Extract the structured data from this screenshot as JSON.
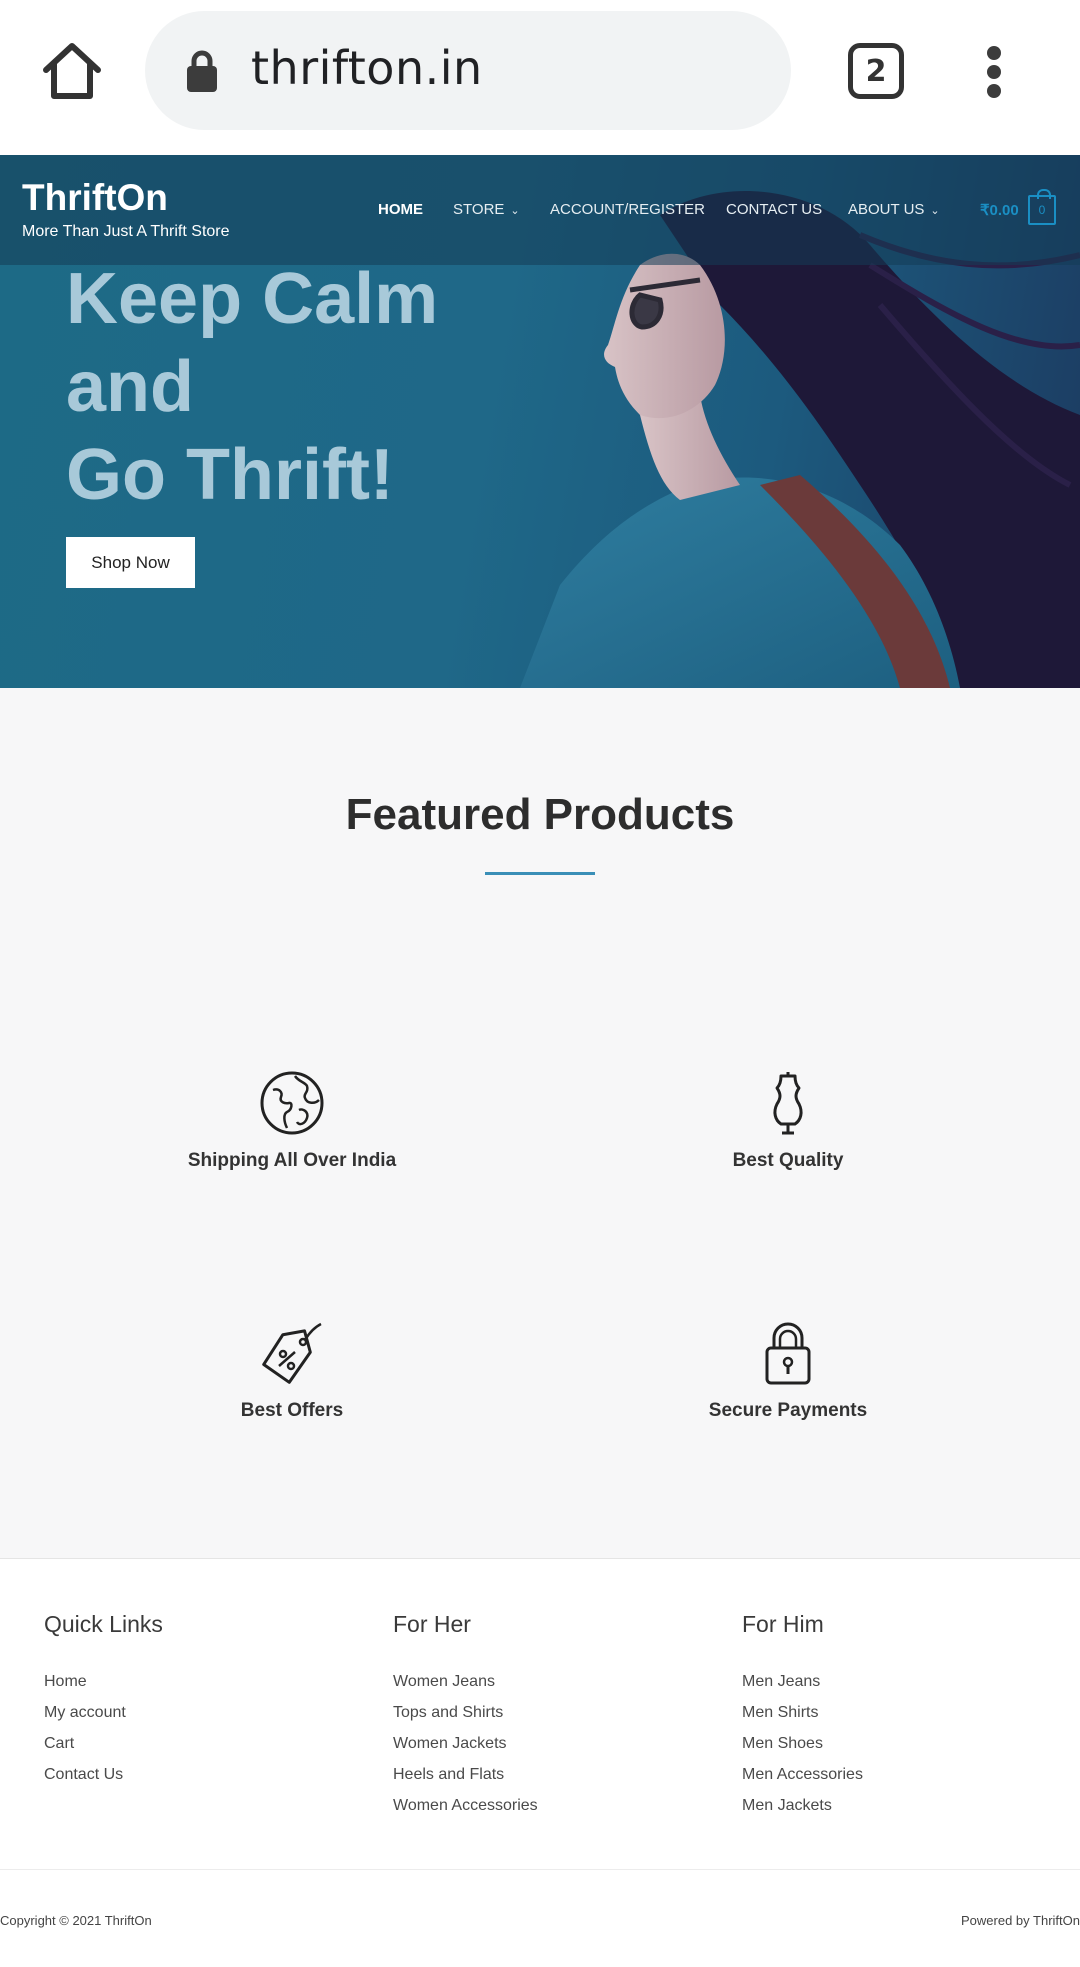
{
  "browser": {
    "url": "thrifton.in",
    "tab_count": "2"
  },
  "site": {
    "title": "ThriftOn",
    "tagline": "More Than Just A Thrift Store"
  },
  "nav": {
    "items": [
      {
        "label": "HOME",
        "active": true,
        "has_dropdown": false
      },
      {
        "label": "STORE",
        "active": false,
        "has_dropdown": true
      },
      {
        "label": "ACCOUNT/REGISTER",
        "active": false,
        "has_dropdown": false
      },
      {
        "label": "CONTACT US",
        "active": false,
        "has_dropdown": false
      },
      {
        "label": "ABOUT US",
        "active": false,
        "has_dropdown": true
      }
    ],
    "cart_amount": "₹0.00",
    "cart_count": "0"
  },
  "hero": {
    "headline_line1": "Keep Calm",
    "headline_line2": "and",
    "headline_line3": "Go Thrift!",
    "button_label": "Shop Now"
  },
  "featured": {
    "title": "Featured Products"
  },
  "features": [
    {
      "label": "Shipping All Over India",
      "icon": "globe-icon"
    },
    {
      "label": "Best Quality",
      "icon": "dress-form-icon"
    },
    {
      "label": "Best Offers",
      "icon": "price-tag-icon"
    },
    {
      "label": "Secure Payments",
      "icon": "padlock-icon"
    }
  ],
  "footer": {
    "columns": [
      {
        "heading": "Quick Links",
        "links": [
          "Home",
          "My account",
          "Cart",
          "Contact Us"
        ]
      },
      {
        "heading": "For Her",
        "links": [
          "Women Jeans",
          "Tops and Shirts",
          "Women Jackets",
          "Heels and Flats",
          "Women Accessories"
        ]
      },
      {
        "heading": "For Him",
        "links": [
          "Men Jeans",
          "Men Shirts",
          "Men Shoes",
          "Men Accessories",
          "Men Jackets"
        ]
      }
    ],
    "copyright": "Copyright © 2021 ThriftOn",
    "powered_by": "Powered by ThriftOn"
  },
  "colors": {
    "accent": "#1a8fc4",
    "hero_bg": "#1f6888",
    "section_bg": "#f7f7f8",
    "underline": "#3a8fb7"
  }
}
